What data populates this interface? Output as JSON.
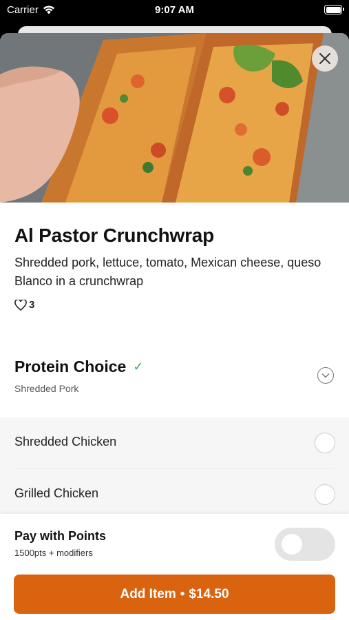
{
  "status_bar": {
    "carrier": "Carrier",
    "time": "9:07 AM"
  },
  "item": {
    "name": "Al Pastor Crunchwrap",
    "description": "Shredded pork, lettuce, tomato, Mexican cheese, queso Blanco in a crunchwrap",
    "likes": "3"
  },
  "section": {
    "title": "Protein Choice",
    "selected": "Shredded Pork",
    "options": [
      {
        "label": "Shredded Chicken"
      },
      {
        "label": "Grilled Chicken"
      }
    ]
  },
  "footer": {
    "pay_title": "Pay with Points",
    "pay_subtitle": "1500pts + modifiers",
    "add_label": "Add Item",
    "separator": "•",
    "price": "$14.50"
  },
  "colors": {
    "accent": "#d9630e",
    "check": "#2db34a"
  }
}
